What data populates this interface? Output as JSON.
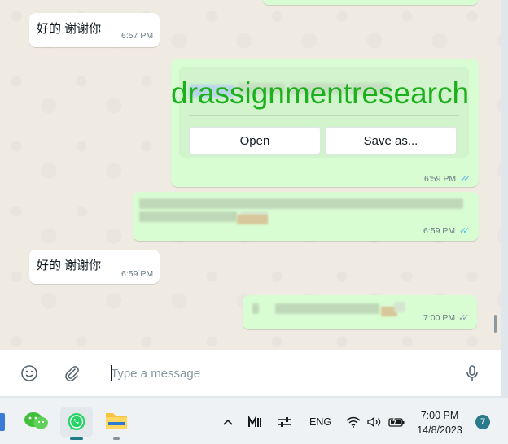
{
  "chat": {
    "messages": [
      {
        "direction": "incoming",
        "text": "好的 谢谢你",
        "time": "6:57 PM"
      },
      {
        "direction": "outgoing",
        "type": "document",
        "open_label": "Open",
        "save_label": "Save as...",
        "time": "6:59 PM",
        "status": "read"
      },
      {
        "direction": "outgoing",
        "type": "text",
        "time": "6:59 PM",
        "status": "read"
      },
      {
        "direction": "incoming",
        "text": "好的 谢谢你",
        "time": "6:59 PM"
      },
      {
        "direction": "outgoing",
        "type": "text",
        "time": "7:00 PM",
        "status": "delivered"
      }
    ],
    "watermark": "drassignmentresearch",
    "ticks": "✓✓"
  },
  "compose": {
    "placeholder": "Type a message",
    "emoji_icon": "emoji-icon",
    "attach_icon": "paperclip-icon",
    "mic_icon": "microphone-icon"
  },
  "taskbar": {
    "language": "ENG",
    "time": "7:00 PM",
    "date": "14/8/2023",
    "notification_count": "7"
  },
  "colors": {
    "outgoing_bubble": "#d9fdd3",
    "incoming_bubble": "#ffffff",
    "read_ticks": "#53bdeb",
    "watermark": "#1cb01c"
  }
}
